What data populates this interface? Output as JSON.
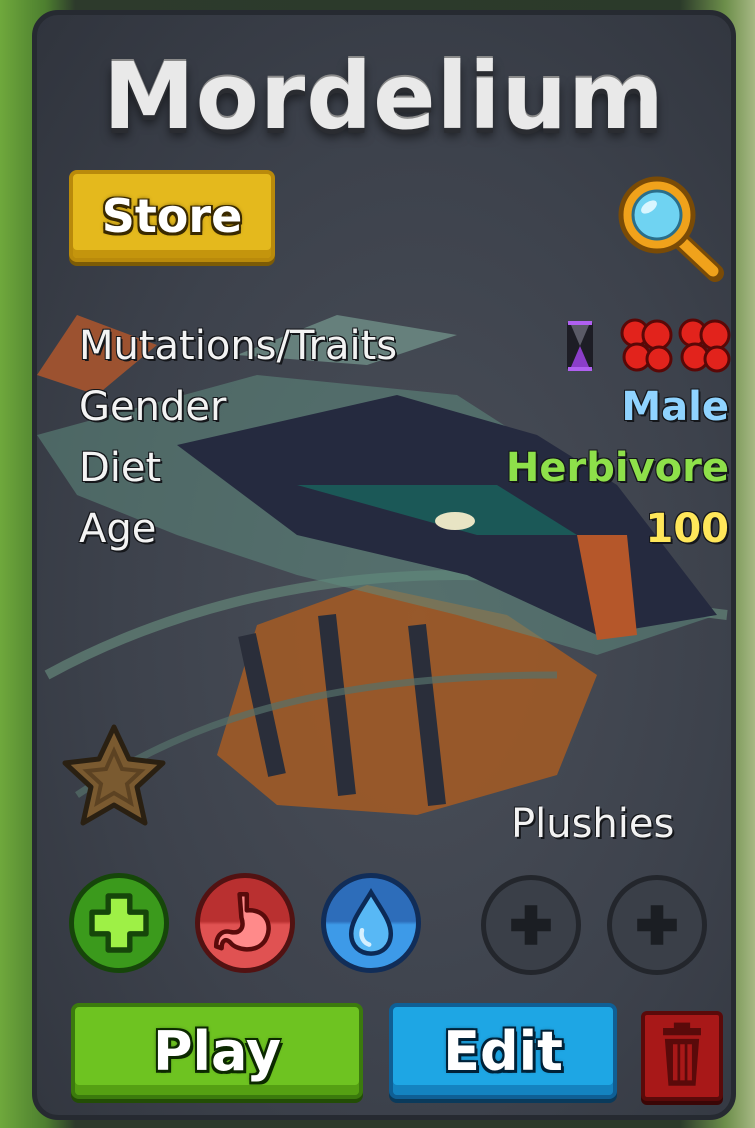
{
  "creature": {
    "name": "Mordelium"
  },
  "store": {
    "label": "Store"
  },
  "stats": {
    "mutations_label": "Mutations/Traits",
    "gender_label": "Gender",
    "gender_value": "Male",
    "diet_label": "Diet",
    "diet_value": "Herbivore",
    "age_label": "Age",
    "age_value": "100"
  },
  "traits": [
    "hourglass-trait-icon",
    "red-cells-trait-icon",
    "red-cells-trait-icon"
  ],
  "plushies": {
    "label": "Plushies"
  },
  "actions": {
    "play_label": "Play",
    "edit_label": "Edit"
  },
  "colors": {
    "gender": "#8fd3ff",
    "diet": "#8ee04a",
    "age": "#ffe75a",
    "store": "#e4b91d",
    "play": "#6ec321",
    "edit": "#1ea6e4",
    "delete": "#a81818"
  }
}
